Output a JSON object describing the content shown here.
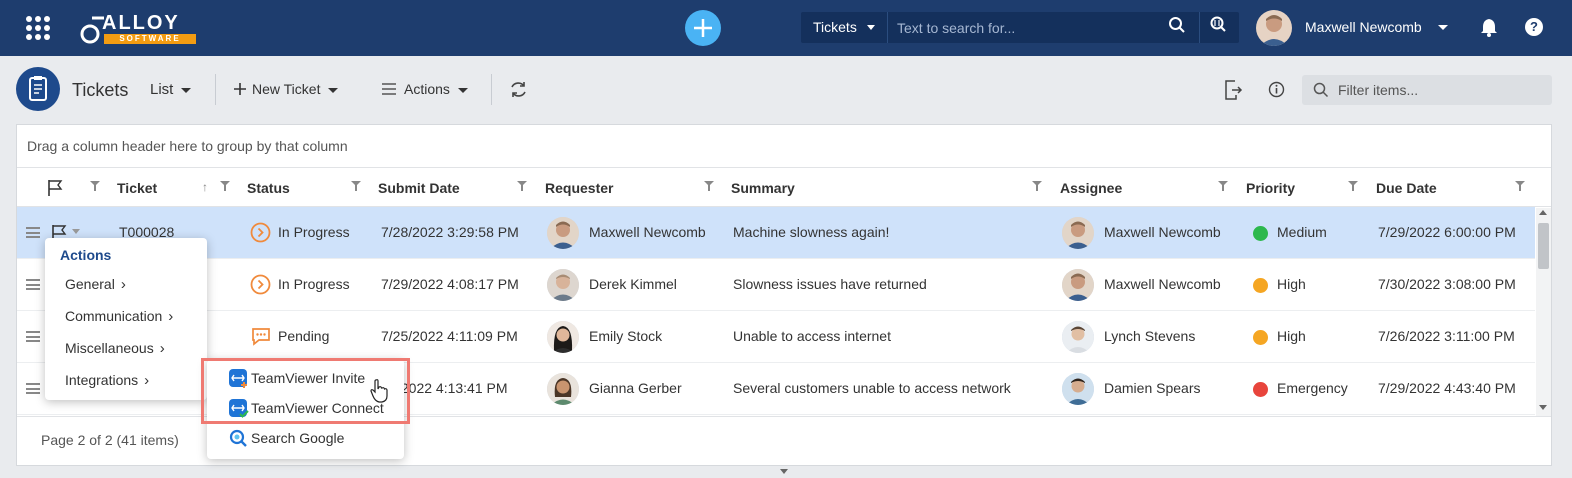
{
  "header": {
    "logo_text": "ALLOY",
    "logo_sub": "SOFTWARE",
    "search_type": "Tickets",
    "search_placeholder": "Text to search for...",
    "user_name": "Maxwell Newcomb"
  },
  "toolbar": {
    "title": "Tickets",
    "view": "List",
    "new_ticket": "New Ticket",
    "actions": "Actions",
    "filter_placeholder": "Filter items..."
  },
  "grid": {
    "group_hint": "Drag a column header here to group by that column",
    "columns": [
      "Ticket",
      "Status",
      "Submit Date",
      "Requester",
      "Summary",
      "Assignee",
      "Priority",
      "Due Date"
    ],
    "rows": [
      {
        "ticket": "T000028",
        "status": "In Progress",
        "submit": "7/28/2022 3:29:58 PM",
        "requester": "Maxwell Newcomb",
        "summary": "Machine slowness again!",
        "assignee": "Maxwell Newcomb",
        "priority": "Medium",
        "due": "7/29/2022 6:00:00 PM"
      },
      {
        "ticket": "",
        "status": "In Progress",
        "submit": "7/29/2022 4:08:17 PM",
        "requester": "Derek Kimmel",
        "summary": "Slowness issues have returned",
        "assignee": "Maxwell Newcomb",
        "priority": "High",
        "due": "7/30/2022 3:08:00 PM"
      },
      {
        "ticket": "",
        "status": "Pending",
        "submit": "7/25/2022 4:11:09 PM",
        "requester": "Emily Stock",
        "summary": "Unable to access internet",
        "assignee": "Lynch Stevens",
        "priority": "High",
        "due": "7/26/2022 3:11:00 PM"
      },
      {
        "ticket": "",
        "status": "",
        "submit": "/2022 4:13:41 PM",
        "requester": "Gianna Gerber",
        "summary": "Several customers unable to access network",
        "assignee": "Damien Spears",
        "priority": "Emergency",
        "due": "7/29/2022 4:43:40 PM"
      }
    ],
    "pager": "Page 2 of 2 (41 items)"
  },
  "colors": {
    "medium": "#2db84d",
    "high": "#f5a623",
    "emergency": "#e8453c",
    "accent": "#1e3d6e"
  },
  "actions_menu": {
    "title": "Actions",
    "items": [
      "General",
      "Communication",
      "Miscellaneous",
      "Integrations"
    ]
  },
  "integrations_menu": {
    "items": [
      "TeamViewer Invite",
      "TeamViewer Connect",
      "Search Google"
    ]
  }
}
